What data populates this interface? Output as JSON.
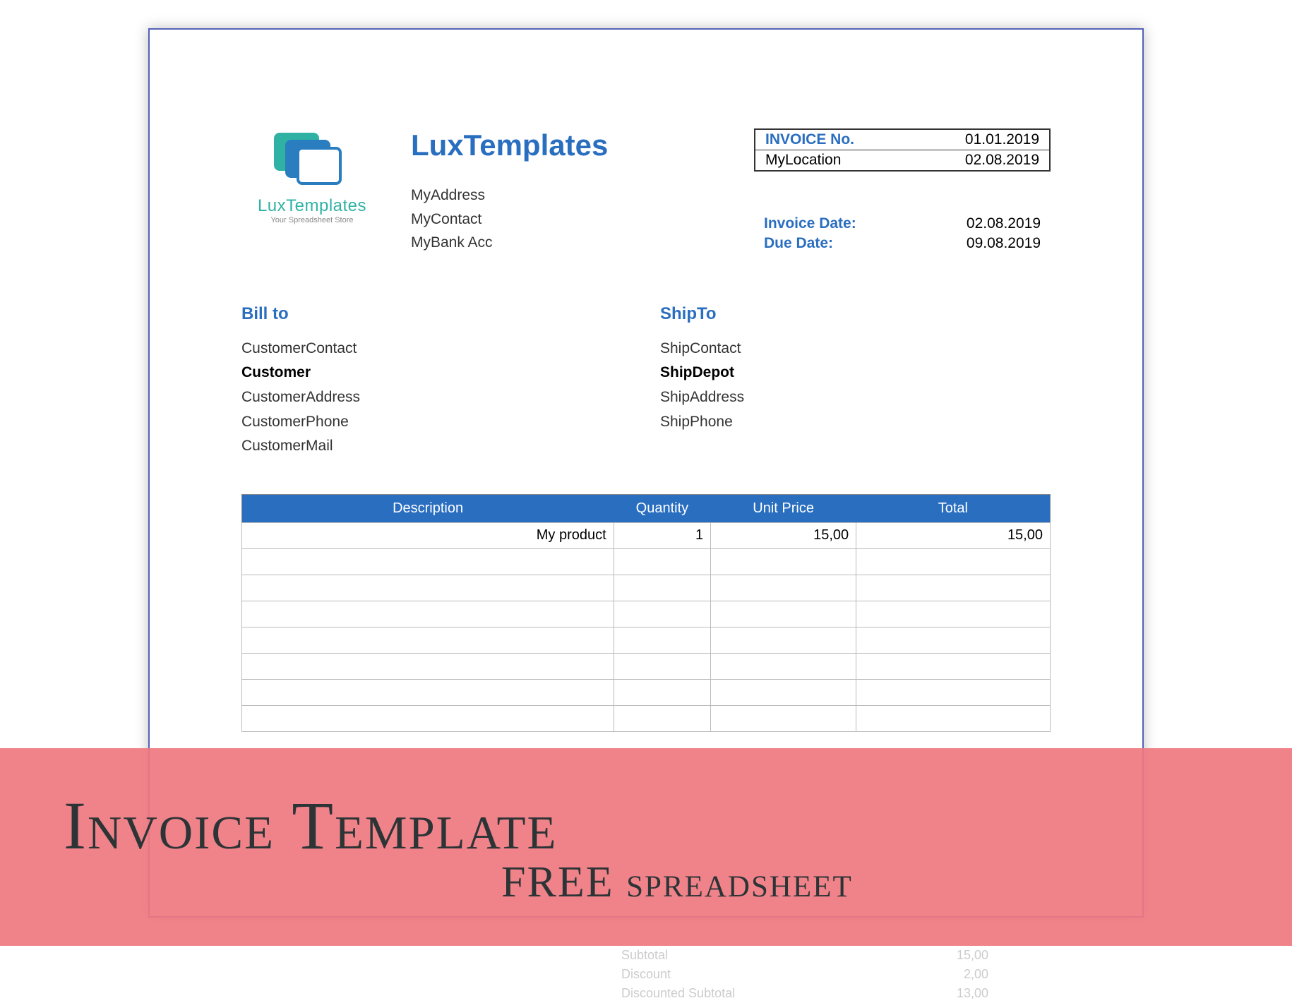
{
  "logo": {
    "name": "LuxTemplates",
    "sub": "Your Spreadsheet Store"
  },
  "company": {
    "name": "LuxTemplates",
    "address": "MyAddress",
    "contact": "MyContact",
    "bank": "MyBank Acc"
  },
  "invoice_box": {
    "no_label": "INVOICE No.",
    "no_value": "01.01.2019",
    "loc_label": "MyLocation",
    "loc_value": "02.08.2019"
  },
  "dates": {
    "inv_label": "Invoice Date:",
    "inv_value": "02.08.2019",
    "due_label": "Due Date:",
    "due_value": "09.08.2019"
  },
  "bill": {
    "title": "Bill to",
    "contact": "CustomerContact",
    "name": "Customer",
    "address": "CustomerAddress",
    "phone": "CustomerPhone",
    "mail": "CustomerMail"
  },
  "ship": {
    "title": "ShipTo",
    "contact": "ShipContact",
    "name": "ShipDepot",
    "address": "ShipAddress",
    "phone": "ShipPhone"
  },
  "table": {
    "headers": {
      "desc": "Description",
      "qty": "Quantity",
      "price": "Unit Price",
      "total": "Total"
    },
    "row": {
      "desc": "My product",
      "qty": "1",
      "price": "15,00",
      "total": "15,00"
    }
  },
  "overlay": {
    "title": "Invoice Template",
    "sub": "FREE spreadsheet"
  },
  "ghost": {
    "sub_l": "Subtotal",
    "sub_v": "15,00",
    "disc_l": "Discount",
    "disc_v": "2,00",
    "dsub_l": "Discounted Subtotal",
    "dsub_v": "13,00"
  }
}
